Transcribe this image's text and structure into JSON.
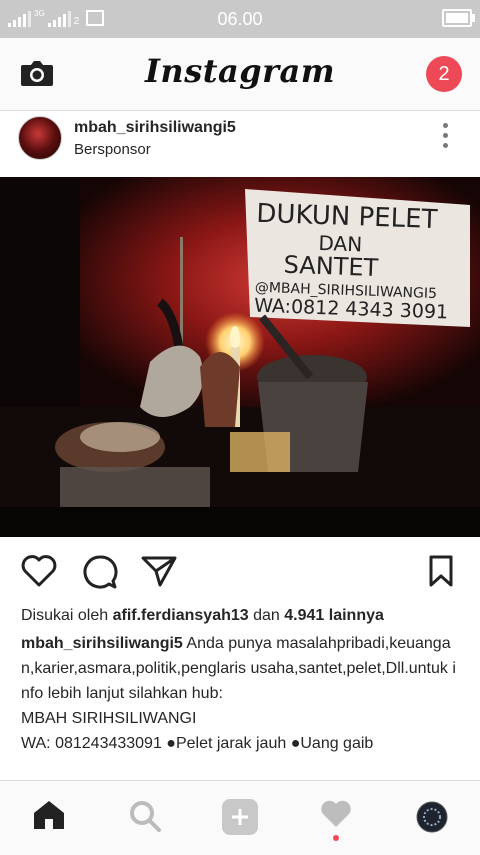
{
  "status_bar": {
    "network_label": "3G",
    "sim_label": "2",
    "time": "06.00",
    "icons": [
      "signal-icon",
      "signal-icon",
      "image-notification-icon",
      "battery-icon"
    ]
  },
  "header": {
    "title": "Instagram",
    "notification_count": "2",
    "icons": [
      "camera-icon"
    ]
  },
  "post": {
    "username": "mbah_sirihsiliwangi5",
    "sponsored_label": "Bersponsor",
    "image_sign": {
      "line1": "DUKUN PELET",
      "line2": "DAN",
      "line3": "SANTET",
      "line4": "@MBAH_SIRIHSILIWANGI5",
      "line5": "WA:0812 4343 3091"
    },
    "likes_prefix": "Disukai oleh",
    "likes_user": "afif.ferdiansyah13",
    "likes_middle": "dan",
    "likes_count": "4.941 lainnya",
    "caption_user": "mbah_sirihsiliwangi5",
    "caption_text": "Anda punya masalahpribadi,keuangan,karier,asmara,politik,penglaris usaha,santet,pelet,Dll.untuk info lebih lanjut silahkan hub:",
    "caption_line2": "MBAH SIRIHSILIWANGI",
    "caption_line3": "WA: 081243433091 ●Pelet jarak jauh ●Uang gaib"
  },
  "actions": [
    "heart-icon",
    "comment-icon",
    "share-icon",
    "bookmark-icon"
  ],
  "tab_bar": [
    "home-icon",
    "search-icon",
    "add-icon",
    "activity-heart-icon",
    "profile-avatar-icon"
  ],
  "colors": {
    "accent_red": "#ed4956",
    "text": "#262626",
    "status_bar_bg": "#c9c9c9"
  }
}
